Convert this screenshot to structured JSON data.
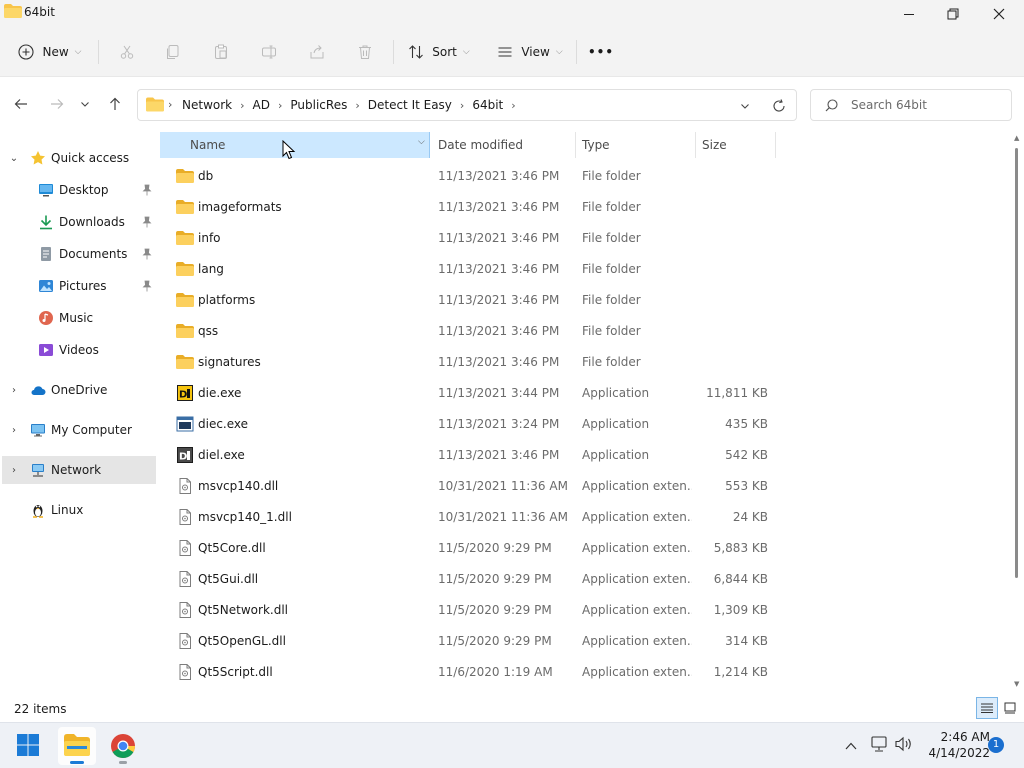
{
  "window": {
    "title": "64bit"
  },
  "toolbar": {
    "new_label": "New",
    "sort_label": "Sort",
    "view_label": "View",
    "more_label": "•••"
  },
  "breadcrumb": [
    "Network",
    "AD",
    "PublicRes",
    "Detect It Easy",
    "64bit"
  ],
  "search": {
    "placeholder": "Search 64bit"
  },
  "sidebar": {
    "quick_access": "Quick access",
    "quick_items": [
      "Desktop",
      "Downloads",
      "Documents",
      "Pictures",
      "Music",
      "Videos"
    ],
    "onedrive": "OneDrive",
    "my_computer": "My Computer",
    "network": "Network",
    "linux": "Linux"
  },
  "columns": {
    "name": "Name",
    "date": "Date modified",
    "type": "Type",
    "size": "Size"
  },
  "files": [
    {
      "icon": "folder",
      "name": "db",
      "date": "11/13/2021 3:46 PM",
      "type": "File folder",
      "size": ""
    },
    {
      "icon": "folder",
      "name": "imageformats",
      "date": "11/13/2021 3:46 PM",
      "type": "File folder",
      "size": ""
    },
    {
      "icon": "folder",
      "name": "info",
      "date": "11/13/2021 3:46 PM",
      "type": "File folder",
      "size": ""
    },
    {
      "icon": "folder",
      "name": "lang",
      "date": "11/13/2021 3:46 PM",
      "type": "File folder",
      "size": ""
    },
    {
      "icon": "folder",
      "name": "platforms",
      "date": "11/13/2021 3:46 PM",
      "type": "File folder",
      "size": ""
    },
    {
      "icon": "folder",
      "name": "qss",
      "date": "11/13/2021 3:46 PM",
      "type": "File folder",
      "size": ""
    },
    {
      "icon": "folder",
      "name": "signatures",
      "date": "11/13/2021 3:46 PM",
      "type": "File folder",
      "size": ""
    },
    {
      "icon": "die-app",
      "name": "die.exe",
      "date": "11/13/2021 3:44 PM",
      "type": "Application",
      "size": "11,811 KB"
    },
    {
      "icon": "console-app",
      "name": "diec.exe",
      "date": "11/13/2021 3:24 PM",
      "type": "Application",
      "size": "435 KB"
    },
    {
      "icon": "die-dark-app",
      "name": "diel.exe",
      "date": "11/13/2021 3:46 PM",
      "type": "Application",
      "size": "542 KB"
    },
    {
      "icon": "dll",
      "name": "msvcp140.dll",
      "date": "10/31/2021 11:36 AM",
      "type": "Application exten...",
      "size": "553 KB"
    },
    {
      "icon": "dll",
      "name": "msvcp140_1.dll",
      "date": "10/31/2021 11:36 AM",
      "type": "Application exten...",
      "size": "24 KB"
    },
    {
      "icon": "dll",
      "name": "Qt5Core.dll",
      "date": "11/5/2020 9:29 PM",
      "type": "Application exten...",
      "size": "5,883 KB"
    },
    {
      "icon": "dll",
      "name": "Qt5Gui.dll",
      "date": "11/5/2020 9:29 PM",
      "type": "Application exten...",
      "size": "6,844 KB"
    },
    {
      "icon": "dll",
      "name": "Qt5Network.dll",
      "date": "11/5/2020 9:29 PM",
      "type": "Application exten...",
      "size": "1,309 KB"
    },
    {
      "icon": "dll",
      "name": "Qt5OpenGL.dll",
      "date": "11/5/2020 9:29 PM",
      "type": "Application exten...",
      "size": "314 KB"
    },
    {
      "icon": "dll",
      "name": "Qt5Script.dll",
      "date": "11/6/2020 1:19 AM",
      "type": "Application exten...",
      "size": "1,214 KB"
    }
  ],
  "status": {
    "item_count": "22 items"
  },
  "taskbar": {
    "time": "2:46 AM",
    "date": "4/14/2022",
    "notification_count": "1"
  }
}
